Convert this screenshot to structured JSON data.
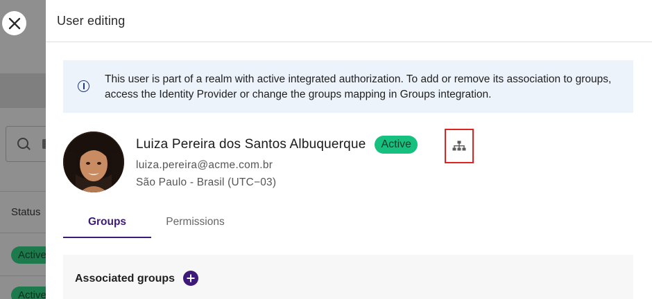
{
  "background": {
    "status_column_label": "Status",
    "status_badges": [
      "Active",
      "Active"
    ]
  },
  "drawer": {
    "title": "User editing",
    "close_icon": "close-icon"
  },
  "info_banner": {
    "icon": "info-icon",
    "text": "This user is part of a realm with active integrated authorization. To add or remove its association to groups, access the Identity Provider or change the groups mapping in Groups integration."
  },
  "user": {
    "name": "Luiza Pereira dos Santos Albuquerque",
    "status": "Active",
    "email": "luiza.pereira@acme.com.br",
    "location": "São Paulo - Brasil (UTC−03)",
    "hierarchy_icon": "hierarchy-icon"
  },
  "tabs": [
    {
      "label": "Groups",
      "active": true
    },
    {
      "label": "Permissions",
      "active": false
    }
  ],
  "groups_section": {
    "title": "Associated groups",
    "add_icon": "plus-circle-icon"
  },
  "colors": {
    "accent": "#3d1a7a",
    "status_green": "#16c180",
    "highlight_red": "#e0231f",
    "banner_bg": "#ecf3fa"
  }
}
